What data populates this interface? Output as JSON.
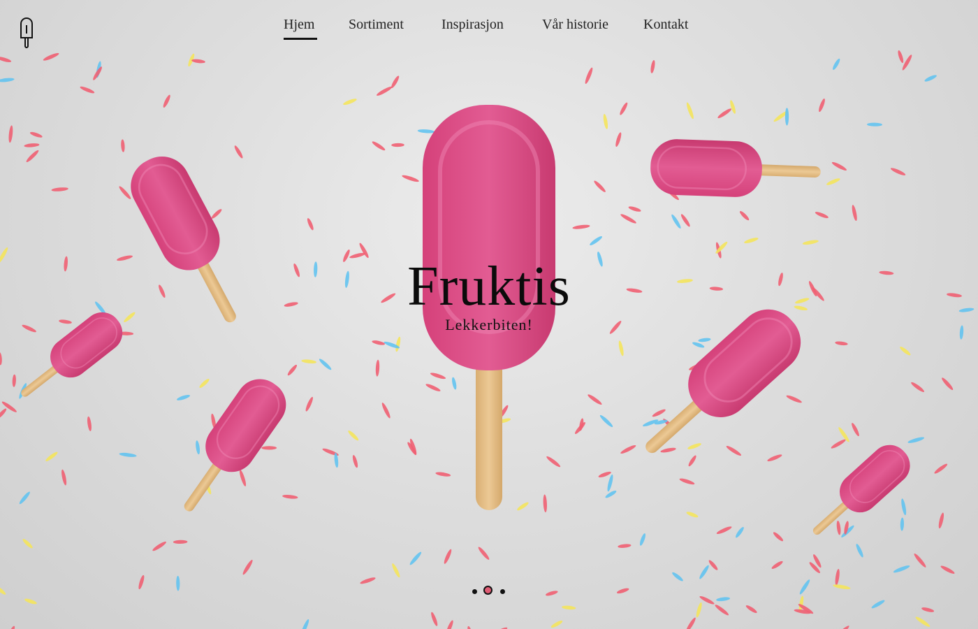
{
  "nav": {
    "items": [
      {
        "label": "Hjem",
        "active": true
      },
      {
        "label": "Sortiment",
        "active": false
      },
      {
        "label": "Inspirasjon",
        "active": false
      },
      {
        "label": "Vår historie",
        "active": false
      },
      {
        "label": "Kontakt",
        "active": false
      }
    ]
  },
  "hero": {
    "title": "Fruktis",
    "subtitle": "Lekkerbiten!"
  },
  "logo": {
    "icon": "popsicle-outline-icon"
  },
  "slider": {
    "slide_count": 3,
    "active_index": 1
  },
  "colors": {
    "accent_pink": "#e05c74",
    "icecream_pink": "#d8467f",
    "sprinkle_red": "#ef5f72",
    "sprinkle_yellow": "#f4e45c",
    "sprinkle_blue": "#63c3ef",
    "stick_wood": "#e4bf86",
    "text": "#111111"
  }
}
